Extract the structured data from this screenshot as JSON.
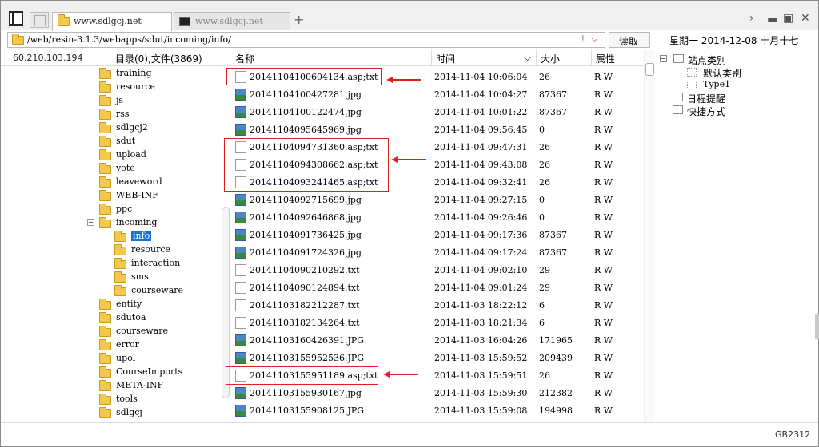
{
  "tabs": [
    {
      "label": "www.sdlgcj.net",
      "icon": "folder-icon",
      "active": true
    },
    {
      "label": "www.sdlgcj.net",
      "icon": "terminal-icon",
      "active": false
    }
  ],
  "address": {
    "path": "/web/resin-3.1.3/webapps/sdut/incoming/info/",
    "read_button": "读取",
    "plus_minus": "±",
    "dropdown": "⌵"
  },
  "date_display": "星期一 2014-12-08 十月十七",
  "header": {
    "ip": "60.210.103.194",
    "dir_info": "目录(0),文件(3869)",
    "col_name": "名称",
    "col_time": "时间",
    "col_size": "大小",
    "col_attr": "属性"
  },
  "tree": [
    {
      "label": "training",
      "depth": 0
    },
    {
      "label": "resource",
      "depth": 0
    },
    {
      "label": "js",
      "depth": 0
    },
    {
      "label": "rss",
      "depth": 0
    },
    {
      "label": "sdlgcj2",
      "depth": 0
    },
    {
      "label": "sdut",
      "depth": 0
    },
    {
      "label": "upload",
      "depth": 0
    },
    {
      "label": "vote",
      "depth": 0
    },
    {
      "label": "leaveword",
      "depth": 0
    },
    {
      "label": "WEB-INF",
      "depth": 0
    },
    {
      "label": "ppc",
      "depth": 0
    },
    {
      "label": "incoming",
      "depth": 0,
      "expanded": true
    },
    {
      "label": "info",
      "depth": 1,
      "selected": true
    },
    {
      "label": "resource",
      "depth": 1
    },
    {
      "label": "interaction",
      "depth": 1
    },
    {
      "label": "sms",
      "depth": 1
    },
    {
      "label": "courseware",
      "depth": 1
    },
    {
      "label": "entity",
      "depth": 0
    },
    {
      "label": "sdutoa",
      "depth": 0
    },
    {
      "label": "courseware",
      "depth": 0
    },
    {
      "label": "error",
      "depth": 0
    },
    {
      "label": "upol",
      "depth": 0
    },
    {
      "label": "CourseImports",
      "depth": 0
    },
    {
      "label": "META-INF",
      "depth": 0
    },
    {
      "label": "tools",
      "depth": 0
    },
    {
      "label": "sdlgcj",
      "depth": 0
    }
  ],
  "files": [
    {
      "name": "20141104100604134.asp;txt",
      "time": "2014-11-04 10:06:04",
      "size": "26",
      "attr": "R W",
      "type": "asp"
    },
    {
      "name": "20141104100427281.jpg",
      "time": "2014-11-04 10:04:27",
      "size": "87367",
      "attr": "R W",
      "type": "img"
    },
    {
      "name": "20141104100122474.jpg",
      "time": "2014-11-04 10:01:22",
      "size": "87367",
      "attr": "R W",
      "type": "img"
    },
    {
      "name": "20141104095645969.jpg",
      "time": "2014-11-04 09:56:45",
      "size": "0",
      "attr": "R W",
      "type": "img"
    },
    {
      "name": "20141104094731360.asp;txt",
      "time": "2014-11-04 09:47:31",
      "size": "26",
      "attr": "R W",
      "type": "asp"
    },
    {
      "name": "20141104094308662.asp;txt",
      "time": "2014-11-04 09:43:08",
      "size": "26",
      "attr": "R W",
      "type": "asp"
    },
    {
      "name": "20141104093241465.asp;txt",
      "time": "2014-11-04 09:32:41",
      "size": "26",
      "attr": "R W",
      "type": "asp"
    },
    {
      "name": "20141104092715699.jpg",
      "time": "2014-11-04 09:27:15",
      "size": "0",
      "attr": "R W",
      "type": "img"
    },
    {
      "name": "20141104092646868.jpg",
      "time": "2014-11-04 09:26:46",
      "size": "0",
      "attr": "R W",
      "type": "img"
    },
    {
      "name": "20141104091736425.jpg",
      "time": "2014-11-04 09:17:36",
      "size": "87367",
      "attr": "R W",
      "type": "img"
    },
    {
      "name": "20141104091724326.jpg",
      "time": "2014-11-04 09:17:24",
      "size": "87367",
      "attr": "R W",
      "type": "img"
    },
    {
      "name": "20141104090210292.txt",
      "time": "2014-11-04 09:02:10",
      "size": "29",
      "attr": "R W",
      "type": "txt"
    },
    {
      "name": "20141104090124894.txt",
      "time": "2014-11-04 09:01:24",
      "size": "29",
      "attr": "R W",
      "type": "txt"
    },
    {
      "name": "20141103182212287.txt",
      "time": "2014-11-03 18:22:12",
      "size": "6",
      "attr": "R W",
      "type": "txt"
    },
    {
      "name": "20141103182134264.txt",
      "time": "2014-11-03 18:21:34",
      "size": "6",
      "attr": "R W",
      "type": "txt"
    },
    {
      "name": "20141103160426391.JPG",
      "time": "2014-11-03 16:04:26",
      "size": "171965",
      "attr": "R W",
      "type": "img"
    },
    {
      "name": "20141103155952536.JPG",
      "time": "2014-11-03 15:59:52",
      "size": "209439",
      "attr": "R W",
      "type": "img"
    },
    {
      "name": "20141103155951189.asp;txt",
      "time": "2014-11-03 15:59:51",
      "size": "26",
      "attr": "R W",
      "type": "asp"
    },
    {
      "name": "20141103155930167.jpg",
      "time": "2014-11-03 15:59:30",
      "size": "212382",
      "attr": "R W",
      "type": "img"
    },
    {
      "name": "20141103155908125.JPG",
      "time": "2014-11-03 15:59:08",
      "size": "194998",
      "attr": "R W",
      "type": "img"
    }
  ],
  "side_panel": {
    "site_category": "站点类别",
    "default_category": "默认类别",
    "type1": "Type1",
    "schedule_reminder": "日程提醒",
    "shortcut": "快捷方式"
  },
  "status": {
    "encoding": "GB2312"
  },
  "colors": {
    "selection": "#1874cd",
    "annotation_red": "#e02020",
    "folder": "#f2c94c"
  }
}
